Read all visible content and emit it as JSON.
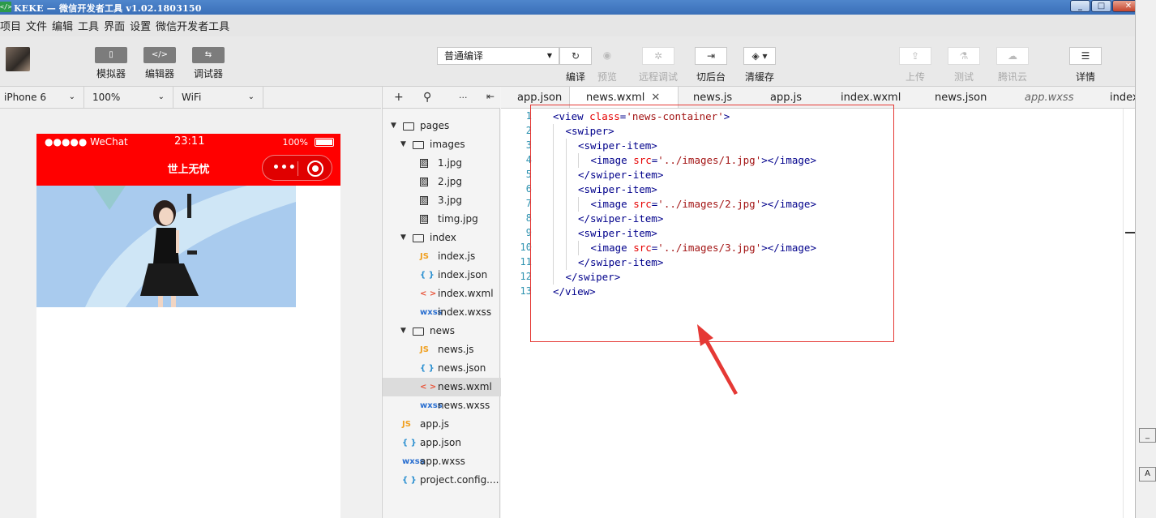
{
  "window": {
    "title": "KEKE — 微信开发者工具 v1.02.1803150",
    "app_icon": "</>",
    "buttons": {
      "minimize": "_",
      "maximize": "□",
      "close": "✕"
    }
  },
  "menu": [
    "项目",
    "文件",
    "编辑",
    "工具",
    "界面",
    "设置",
    "微信开发者工具"
  ],
  "toolbar": {
    "simulator": "模拟器",
    "editor": "编辑器",
    "debugger": "调试器",
    "editor_icon": "</>",
    "compile_mode": "普通编译",
    "compile": "编译",
    "preview": "预览",
    "remote_debug": "远程调试",
    "background": "切后台",
    "clear_cache": "清缓存",
    "upload": "上传",
    "test": "测试",
    "tencent_cloud": "腾讯云",
    "details": "详情"
  },
  "devicebar": {
    "device": "iPhone 6",
    "zoom": "100%",
    "network": "WiFi"
  },
  "phone": {
    "carrier": "●●●●● WeChat",
    "time": "23:11",
    "battery": "100%",
    "nav_title": "世上无忧",
    "nav_color": "#ff0000"
  },
  "filetree": [
    {
      "label": "pages",
      "type": "folder",
      "depth": 0,
      "expanded": true
    },
    {
      "label": "images",
      "type": "folder",
      "depth": 1,
      "expanded": true
    },
    {
      "label": "1.jpg",
      "type": "image",
      "depth": 2
    },
    {
      "label": "2.jpg",
      "type": "image",
      "depth": 2
    },
    {
      "label": "3.jpg",
      "type": "image",
      "depth": 2
    },
    {
      "label": "timg.jpg",
      "type": "image",
      "depth": 2
    },
    {
      "label": "index",
      "type": "folder",
      "depth": 1,
      "expanded": true
    },
    {
      "label": "index.js",
      "type": "js",
      "depth": 2
    },
    {
      "label": "index.json",
      "type": "json",
      "depth": 2
    },
    {
      "label": "index.wxml",
      "type": "wxml",
      "depth": 2
    },
    {
      "label": "index.wxss",
      "type": "wxss",
      "depth": 2
    },
    {
      "label": "news",
      "type": "folder",
      "depth": 1,
      "expanded": true
    },
    {
      "label": "news.js",
      "type": "js",
      "depth": 2
    },
    {
      "label": "news.json",
      "type": "json",
      "depth": 2
    },
    {
      "label": "news.wxml",
      "type": "wxml",
      "depth": 2,
      "selected": true
    },
    {
      "label": "news.wxss",
      "type": "wxss",
      "depth": 2
    },
    {
      "label": "app.js",
      "type": "js",
      "depth": 0,
      "root": true
    },
    {
      "label": "app.json",
      "type": "json",
      "depth": 0,
      "root": true
    },
    {
      "label": "app.wxss",
      "type": "wxss",
      "depth": 0,
      "root": true
    },
    {
      "label": "project.config....",
      "type": "json",
      "depth": 0,
      "root": true
    }
  ],
  "tabs": [
    {
      "label": "app.json"
    },
    {
      "label": "news.wxml",
      "active": true,
      "close": "✕"
    },
    {
      "label": "news.js"
    },
    {
      "label": "app.js"
    },
    {
      "label": "index.wxml"
    },
    {
      "label": "news.json"
    },
    {
      "label": "app.wxss",
      "italic": true
    },
    {
      "label": "index"
    }
  ],
  "code": [
    {
      "n": "1",
      "indent": 0,
      "parts": [
        [
          "tag",
          "<view "
        ],
        [
          "attr",
          "class"
        ],
        [
          "tag",
          "="
        ],
        [
          "str",
          "'news-container'"
        ],
        [
          "tag",
          ">"
        ]
      ]
    },
    {
      "n": "2",
      "indent": 1,
      "parts": [
        [
          "tag",
          "<swiper>"
        ]
      ]
    },
    {
      "n": "3",
      "indent": 2,
      "parts": [
        [
          "tag",
          "<swiper-item>"
        ]
      ]
    },
    {
      "n": "4",
      "indent": 3,
      "parts": [
        [
          "tag",
          "<image "
        ],
        [
          "attr",
          "src"
        ],
        [
          "tag",
          "="
        ],
        [
          "str",
          "'../images/1.jpg'"
        ],
        [
          "tag",
          "></image>"
        ]
      ]
    },
    {
      "n": "5",
      "indent": 2,
      "parts": [
        [
          "tag",
          "</swiper-item>"
        ]
      ]
    },
    {
      "n": "6",
      "indent": 2,
      "parts": [
        [
          "tag",
          "<swiper-item>"
        ]
      ]
    },
    {
      "n": "7",
      "indent": 3,
      "parts": [
        [
          "tag",
          "<image "
        ],
        [
          "attr",
          "src"
        ],
        [
          "tag",
          "="
        ],
        [
          "str",
          "'../images/2.jpg'"
        ],
        [
          "tag",
          "></image>"
        ]
      ]
    },
    {
      "n": "8",
      "indent": 2,
      "parts": [
        [
          "tag",
          "</swiper-item>"
        ]
      ]
    },
    {
      "n": "9",
      "indent": 2,
      "parts": [
        [
          "tag",
          "<swiper-item>"
        ]
      ]
    },
    {
      "n": "10",
      "indent": 3,
      "parts": [
        [
          "tag",
          "<image "
        ],
        [
          "attr",
          "src"
        ],
        [
          "tag",
          "="
        ],
        [
          "str",
          "'../images/3.jpg'"
        ],
        [
          "tag",
          "></image>"
        ]
      ]
    },
    {
      "n": "11",
      "indent": 2,
      "parts": [
        [
          "tag",
          "</swiper-item>"
        ]
      ]
    },
    {
      "n": "12",
      "indent": 1,
      "parts": [
        [
          "tag",
          "</swiper>"
        ]
      ]
    },
    {
      "n": "13",
      "indent": 0,
      "parts": [
        [
          "tag",
          "</view>"
        ]
      ]
    }
  ],
  "right_panel": {
    "btn1": "_",
    "btn2": "A"
  },
  "colors": {
    "accent_red": "#ff0000",
    "annotation": "#e53935",
    "tag": "#00008b",
    "attr": "#e50000",
    "string": "#a31515"
  }
}
